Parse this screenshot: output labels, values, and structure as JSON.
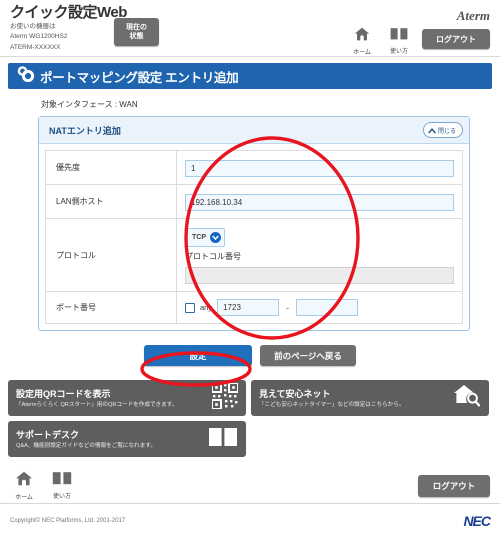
{
  "header": {
    "brand_title": "クイック設定Web",
    "brand_sub_1": "お使いの機器は",
    "brand_sub_2": "Aterm WG1200HS2",
    "brand_sub_3": "ATERM-XXXXXX",
    "status_button_line1": "現在の",
    "status_button_line2": "状態",
    "logo": "Aterm",
    "nav": [
      {
        "label": "ホーム",
        "icon": "home-icon"
      },
      {
        "label": "使い方",
        "icon": "book-icon"
      }
    ],
    "logout_label": "ログアウト"
  },
  "page_title": "ポートマッピング設定 エントリ追加",
  "interface_label": "対象インタフェース : WAN",
  "panel": {
    "title": "NATエントリ追加",
    "close_label": "閉じる",
    "rows": {
      "priority": {
        "label": "優先度",
        "value": "1"
      },
      "lan_host": {
        "label": "LAN側ホスト",
        "value": "192.168.10.34"
      },
      "protocol": {
        "label": "プロトコル",
        "selected": "TCP",
        "number_label": "プロトコル番号",
        "number_value": ""
      },
      "port": {
        "label": "ポート番号",
        "any_label": "any",
        "any_checked": false,
        "start": "1723",
        "separator": "-",
        "end": ""
      }
    }
  },
  "actions": {
    "submit_label": "設定",
    "back_label": "前のページへ戻る"
  },
  "cards": [
    {
      "title": "設定用QRコードを表示",
      "subtitle": "「Atermらくらく QRスタート」用のQRコードを作成できます。",
      "icon": "qr-code-icon"
    },
    {
      "title": "見えて安心ネット",
      "subtitle": "「こども安心ネットタイマー」などの設定はこちらから。",
      "icon": "home-search-icon"
    },
    {
      "title": "サポートデスク",
      "subtitle": "Q&A、機能別設定ガイドなどの情報をご覧になれます。",
      "icon": "book-icon"
    }
  ],
  "footer": {
    "nav": [
      {
        "label": "ホーム",
        "icon": "home-icon"
      },
      {
        "label": "使い方",
        "icon": "book-icon"
      }
    ],
    "logout_label": "ログアウト",
    "copyright": "Copyright© NEC Platforms, Ltd. 2001-2017",
    "logo": "NEC"
  },
  "colors": {
    "title_blue": "#1f64ae",
    "primary_blue": "#1f6fbd",
    "grey_button": "#6e6e6e",
    "card_grey": "#5e5e5e",
    "annotation_red": "#e8141e",
    "field_blue_border": "#a8cdea",
    "nec_blue": "#1a3d8f"
  }
}
